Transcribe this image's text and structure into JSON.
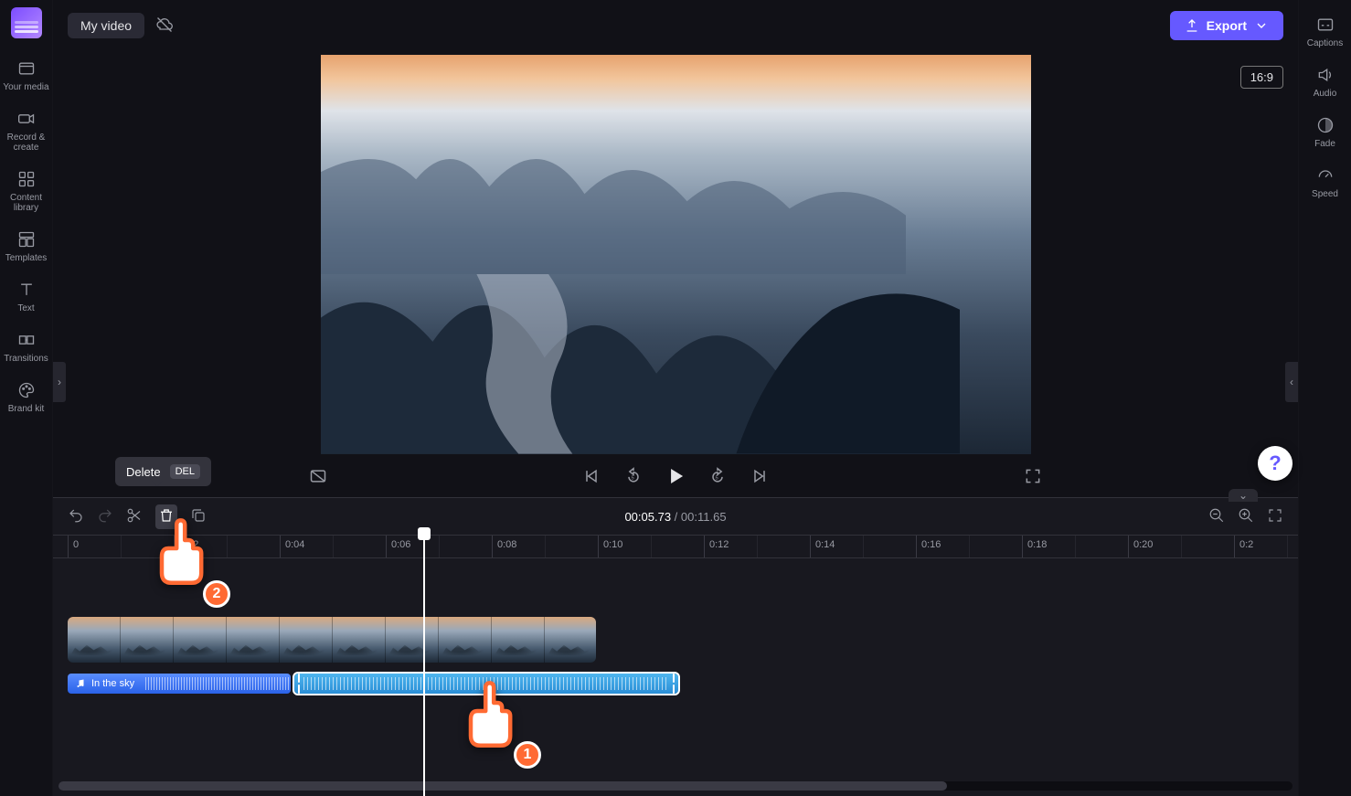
{
  "project_title": "My video",
  "export_label": "Export",
  "aspect_ratio": "16:9",
  "tooltip": {
    "text": "Delete",
    "kbd": "DEL"
  },
  "time": {
    "current": "00:05.73",
    "total": "00:11.65"
  },
  "left_sidebar": [
    {
      "id": "your-media",
      "label": "Your media"
    },
    {
      "id": "record-create",
      "label": "Record &\ncreate"
    },
    {
      "id": "content-library",
      "label": "Content\nlibrary"
    },
    {
      "id": "templates",
      "label": "Templates"
    },
    {
      "id": "text",
      "label": "Text"
    },
    {
      "id": "transitions",
      "label": "Transitions"
    },
    {
      "id": "brand-kit",
      "label": "Brand kit"
    }
  ],
  "right_sidebar": [
    {
      "id": "captions",
      "label": "Captions"
    },
    {
      "id": "audio",
      "label": "Audio"
    },
    {
      "id": "fade",
      "label": "Fade"
    },
    {
      "id": "speed",
      "label": "Speed"
    }
  ],
  "ruler": [
    "0",
    "0:02",
    "0:04",
    "0:06",
    "0:08",
    "0:10",
    "0:12",
    "0:14",
    "0:16",
    "0:18",
    "0:20",
    "0:2"
  ],
  "audio_clip_label": "In the sky",
  "help": "?",
  "annotations": {
    "pointer1": "1",
    "pointer2": "2"
  }
}
